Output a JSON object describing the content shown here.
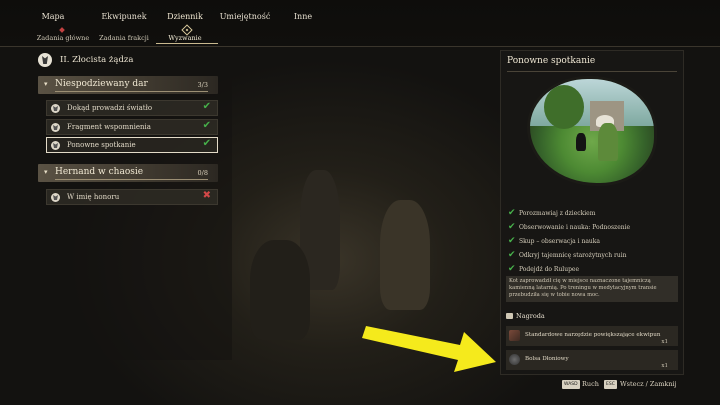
{
  "nav": {
    "tabs": [
      "Mapa",
      "Ekwipunek",
      "Dziennik",
      "Umiejętność",
      "Inne"
    ],
    "subtabs": [
      "Zadania główne",
      "Zadania frakcji",
      "Wyzwanie"
    ]
  },
  "journal": {
    "title": "II. Złocista żądza",
    "groups": [
      {
        "title": "Niespodziewany dar",
        "count": "3/3",
        "quests": [
          {
            "label": "Dokąd prowadzi światło",
            "status": "✔"
          },
          {
            "label": "Fragment wspomnienia",
            "status": "✔"
          },
          {
            "label": "Ponowne spotkanie",
            "status": "✔"
          }
        ]
      },
      {
        "title": "Hernand w chaosie",
        "count": "0/8",
        "quests": [
          {
            "label": "W imię honoru",
            "status": "✖"
          }
        ]
      }
    ]
  },
  "detail": {
    "title": "Ponowne spotkanie",
    "objectives": [
      "Porozmawiaj z dzieckiem",
      "Obserwowanie i nauka: Podnoszenie",
      "Skup – obserwacja i nauka",
      "Odkryj tajemnicę starożytnych ruin",
      "Podejdź do Rulupee"
    ],
    "description": "Kot zaprowadził cię w miejsce naznaczone tajemniczą kamienną latarnią. Po treningu w medytacyjnym transie przebudziła się w tobie nowa moc.",
    "reward_header": "Nagroda",
    "rewards": [
      {
        "name": "Standardowe narzędzie powiększające ekwipun",
        "qty": "x1"
      },
      {
        "name": "Bolsa Dłoniowy",
        "qty": "x1"
      }
    ]
  },
  "footer": {
    "move_key": "WASD",
    "move_label": "Ruch",
    "back_key": "ESC",
    "back_label": "Wstecz / Zamknij"
  },
  "colors": {
    "check": "#46b04a",
    "fail": "#d24848",
    "arrow": "#f5ea1c"
  }
}
